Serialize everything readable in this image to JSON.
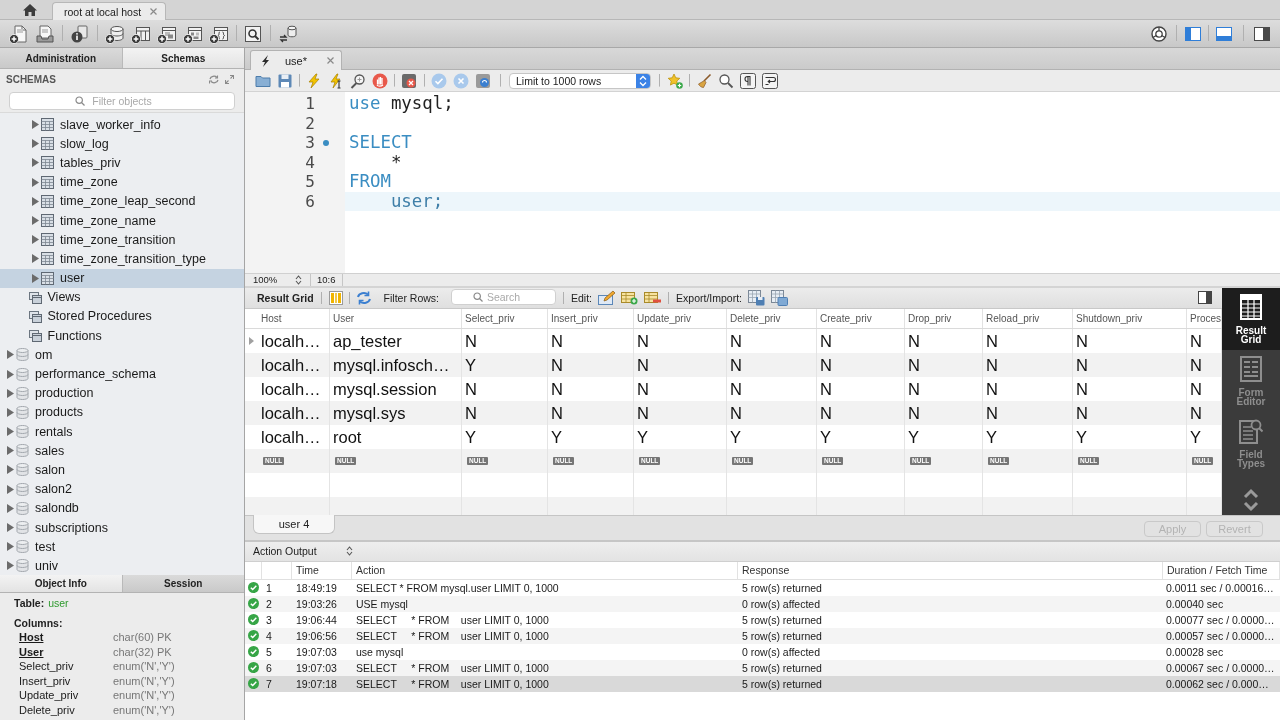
{
  "top_tabs": [
    {
      "label": "root at local host",
      "selected": true
    }
  ],
  "panel_toggles": [
    {
      "kind": "left",
      "on": true
    },
    {
      "kind": "bottom",
      "on": true
    },
    {
      "kind": "right",
      "on": false
    }
  ],
  "sidebar": {
    "tabs": [
      {
        "label": "Administration",
        "selected": false
      },
      {
        "label": "Schemas",
        "selected": true
      }
    ],
    "title": "SCHEMAS",
    "filter": {
      "placeholder": "Filter objects"
    },
    "tree": [
      {
        "children": [
          {
            "children": [
              {
                "kind": "table",
                "label": "slave_worker_info",
                "expanded": false,
                "selected": false
              },
              {
                "kind": "table",
                "label": "slow_log",
                "expanded": false,
                "selected": false
              },
              {
                "kind": "table",
                "label": "tables_priv",
                "expanded": false,
                "selected": false
              },
              {
                "kind": "table",
                "label": "time_zone",
                "expanded": false,
                "selected": false
              },
              {
                "kind": "table",
                "label": "time_zone_leap_second",
                "expanded": false,
                "selected": false
              },
              {
                "kind": "table",
                "label": "time_zone_name",
                "expanded": false,
                "selected": false
              },
              {
                "kind": "table",
                "label": "time_zone_transition",
                "expanded": false,
                "selected": false
              },
              {
                "kind": "table",
                "label": "time_zone_transition_type",
                "expanded": false,
                "selected": false
              },
              {
                "kind": "table",
                "label": "user",
                "expanded": false,
                "selected": true
              }
            ]
          },
          {
            "kind": "folder",
            "label": "Views",
            "selected": false
          },
          {
            "kind": "folder",
            "label": "Stored Procedures",
            "selected": false
          },
          {
            "kind": "folder",
            "label": "Functions",
            "selected": false
          }
        ]
      },
      {
        "kind": "schema",
        "label": "om",
        "expanded": false,
        "selected": false
      },
      {
        "kind": "schema",
        "label": "performance_schema",
        "expanded": false,
        "selected": false
      },
      {
        "kind": "schema",
        "label": "production",
        "expanded": false,
        "selected": false
      },
      {
        "kind": "schema",
        "label": "products",
        "expanded": false,
        "selected": false
      },
      {
        "kind": "schema",
        "label": "rentals",
        "expanded": false,
        "selected": false
      },
      {
        "kind": "schema",
        "label": "sales",
        "expanded": false,
        "selected": false
      },
      {
        "kind": "schema",
        "label": "salon",
        "expanded": false,
        "selected": false
      },
      {
        "kind": "schema",
        "label": "salon2",
        "expanded": false,
        "selected": false
      },
      {
        "kind": "schema",
        "label": "salondb",
        "expanded": false,
        "selected": false
      },
      {
        "kind": "schema",
        "label": "subscriptions",
        "expanded": false,
        "selected": false
      },
      {
        "kind": "schema",
        "label": "test",
        "expanded": false,
        "selected": false
      },
      {
        "kind": "schema",
        "label": "univ",
        "expanded": false,
        "selected": false
      }
    ],
    "info_tabs": [
      {
        "label": "Object Info",
        "selected": true
      },
      {
        "label": "Session",
        "selected": false
      }
    ],
    "object_info": {
      "table_label": "Table:",
      "table_name": "user",
      "columns_label": "Columns:",
      "columns": [
        {
          "name": "Host",
          "type": "char(60) PK",
          "primary_key": true
        },
        {
          "name": "User",
          "type": "char(32) PK",
          "primary_key": true
        },
        {
          "name": "Select_priv",
          "type": "enum('N','Y')",
          "primary_key": false
        },
        {
          "name": "Insert_priv",
          "type": "enum('N','Y')",
          "primary_key": false
        },
        {
          "name": "Update_priv",
          "type": "enum('N','Y')",
          "primary_key": false
        },
        {
          "name": "Delete_priv",
          "type": "enum('N','Y')",
          "primary_key": false
        }
      ]
    }
  },
  "editor": {
    "tabs": [
      {
        "label": "use*",
        "selected": true
      }
    ],
    "limit": "Limit to 1000 rows",
    "lines": [
      {
        "number": "1",
        "marker": false,
        "current": false,
        "tokens": [
          {
            "kind": "keyword",
            "text": "use"
          },
          {
            "kind": "plain",
            "text": " mysql;"
          }
        ]
      },
      {
        "number": "2",
        "marker": false,
        "current": false
      },
      {
        "number": "3",
        "marker": true,
        "current": false,
        "tokens": [
          {
            "kind": "keyword",
            "text": "SELECT"
          }
        ]
      },
      {
        "number": "4",
        "marker": false,
        "current": false,
        "tokens": [
          {
            "kind": "plain",
            "text": "    *"
          }
        ]
      },
      {
        "number": "5",
        "marker": false,
        "current": false,
        "tokens": [
          {
            "kind": "keyword",
            "text": "FROM"
          }
        ]
      },
      {
        "number": "6",
        "marker": false,
        "current": true,
        "tokens": [
          {
            "kind": "identifier",
            "text": "    user;"
          }
        ]
      }
    ],
    "zoom": "100%",
    "position": "10:6"
  },
  "results": {
    "view_label": "Result Grid",
    "filter_label": "Filter Rows:",
    "search": {
      "placeholder": "Search"
    },
    "edit_label": "Edit:",
    "export_label": "Export/Import:",
    "columns": [
      "Host",
      "User",
      "Select_priv",
      "Insert_priv",
      "Update_priv",
      "Delete_priv",
      "Create_priv",
      "Drop_priv",
      "Reload_priv",
      "Shutdown_priv",
      "Proces"
    ],
    "rows": [
      {
        "current": true,
        "cells": [
          "localh…",
          "ap_tester",
          "N",
          "N",
          "N",
          "N",
          "N",
          "N",
          "N",
          "N",
          "N"
        ]
      },
      {
        "current": false,
        "cells": [
          "localh…",
          "mysql.infosch…",
          "Y",
          "N",
          "N",
          "N",
          "N",
          "N",
          "N",
          "N",
          "N"
        ]
      },
      {
        "current": false,
        "cells": [
          "localh…",
          "mysql.session",
          "N",
          "N",
          "N",
          "N",
          "N",
          "N",
          "N",
          "N",
          "N"
        ]
      },
      {
        "current": false,
        "cells": [
          "localh…",
          "mysql.sys",
          "N",
          "N",
          "N",
          "N",
          "N",
          "N",
          "N",
          "N",
          "N"
        ]
      },
      {
        "current": false,
        "cells": [
          "localh…",
          "root",
          "Y",
          "Y",
          "Y",
          "Y",
          "Y",
          "Y",
          "Y",
          "Y",
          "Y"
        ]
      }
    ],
    "new_row": [
      "NULL",
      "NULL",
      "NULL",
      "NULL",
      "NULL",
      "NULL",
      "NULL",
      "NULL",
      "NULL",
      "NULL",
      "NULL"
    ],
    "tabs": [
      {
        "label": "user 4",
        "selected": true
      }
    ],
    "buttons": [
      {
        "label": "Apply",
        "disabled": true
      },
      {
        "label": "Revert",
        "disabled": true
      }
    ],
    "views": [
      {
        "kind": "grid",
        "label": "Result Grid",
        "selected": true
      },
      {
        "kind": "form",
        "label": "Form Editor",
        "selected": false
      },
      {
        "kind": "fields",
        "label": "Field Types",
        "selected": false
      }
    ]
  },
  "action_output": {
    "title": "Action Output",
    "columns": [
      "Time",
      "Action",
      "Response",
      "Duration / Fetch Time"
    ],
    "rows": [
      {
        "success": true,
        "number": "1",
        "time": "18:49:19",
        "action": "SELECT * FROM mysql.user LIMIT 0, 1000",
        "response": "5 row(s) returned",
        "duration": "0.0011 sec / 0.00016…",
        "selected": false
      },
      {
        "success": true,
        "number": "2",
        "time": "19:03:26",
        "action": "USE mysql",
        "response": "0 row(s) affected",
        "duration": "0.00040 sec",
        "selected": false
      },
      {
        "success": true,
        "number": "3",
        "time": "19:06:44",
        "action": "SELECT     * FROM    user LIMIT 0, 1000",
        "response": "5 row(s) returned",
        "duration": "0.00077 sec / 0.0000…",
        "selected": false
      },
      {
        "success": true,
        "number": "4",
        "time": "19:06:56",
        "action": "SELECT     * FROM    user LIMIT 0, 1000",
        "response": "5 row(s) returned",
        "duration": "0.00057 sec / 0.0000…",
        "selected": false
      },
      {
        "success": true,
        "number": "5",
        "time": "19:07:03",
        "action": "use mysql",
        "response": "0 row(s) affected",
        "duration": "0.00028 sec",
        "selected": false
      },
      {
        "success": true,
        "number": "6",
        "time": "19:07:03",
        "action": "SELECT     * FROM    user LIMIT 0, 1000",
        "response": "5 row(s) returned",
        "duration": "0.00067 sec / 0.0000…",
        "selected": false
      },
      {
        "success": true,
        "number": "7",
        "time": "19:07:18",
        "action": "SELECT     * FROM    user LIMIT 0, 1000",
        "response": "5 row(s) returned",
        "duration": "0.00062 sec / 0.000…",
        "selected": true
      }
    ]
  }
}
